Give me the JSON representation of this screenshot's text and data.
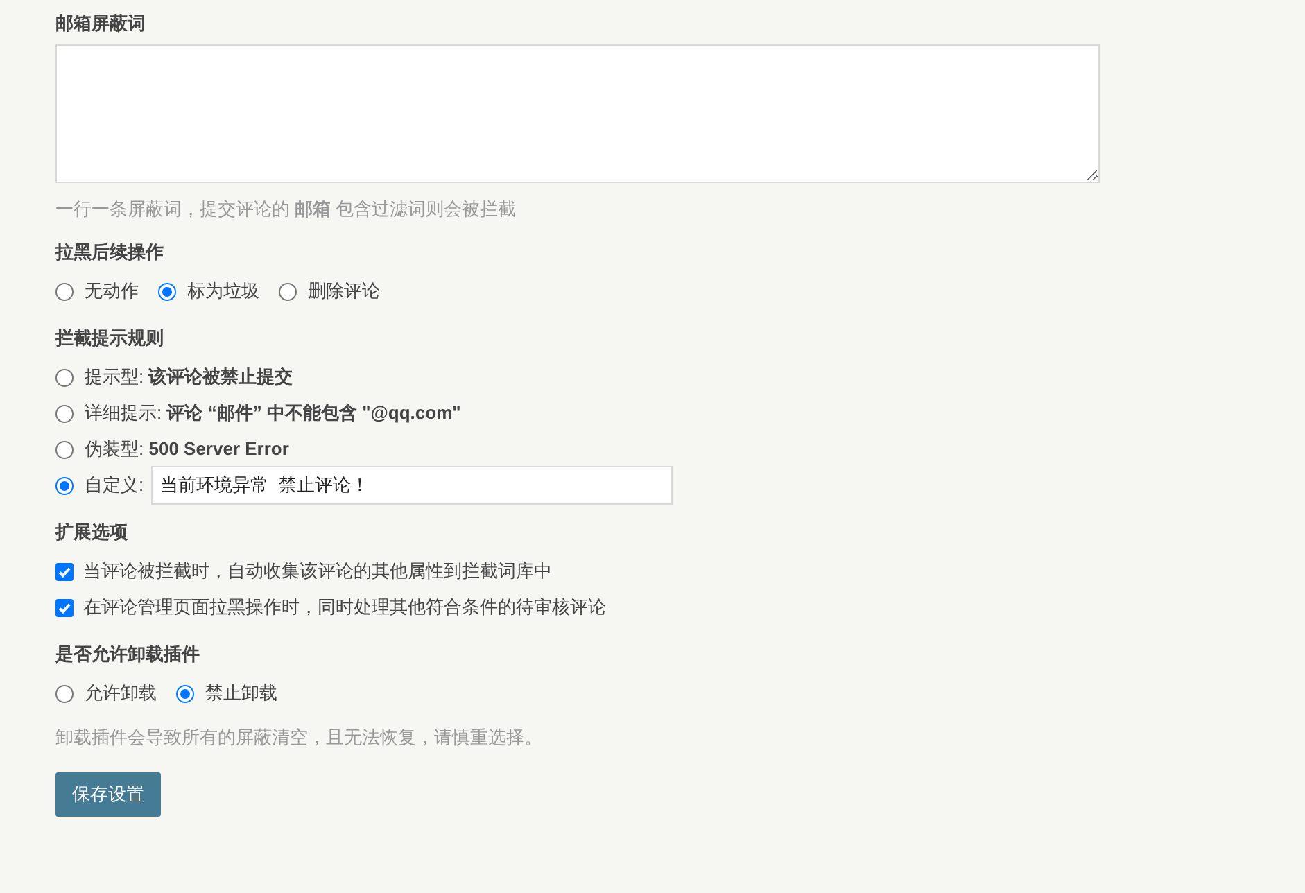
{
  "sections": [
    {
      "kind": "textarea",
      "title": "邮箱屏蔽词",
      "hint": "一行一条屏蔽词，提交评论的 **邮箱** 包含过滤词则会被拦截"
    },
    {
      "kind": "radio-inline",
      "title": "拉黑后续操作",
      "options": [
        {
          "label": "无动作",
          "selected": false
        },
        {
          "label": "标为垃圾",
          "selected": true
        },
        {
          "label": "删除评论",
          "selected": false
        }
      ]
    },
    {
      "kind": "radio-list",
      "title": "拦截提示规则",
      "options": [
        {
          "label": "提示型: **该评论被禁止提交**",
          "selected": false
        },
        {
          "label": "详细提示: **评论 “邮件” 中不能包含 \"@qq.com\"**",
          "selected": false
        },
        {
          "label": "伪装型: **500 Server Error**",
          "selected": false
        },
        {
          "label": "自定义:",
          "selected": true,
          "value": "当前环境异常  禁止评论！"
        }
      ]
    },
    {
      "kind": "checkbox-list",
      "title": "扩展选项",
      "options": [
        {
          "label": "当评论被拦截时，自动收集该评论的其他属性到拦截词库中",
          "checked": true
        },
        {
          "label": "在评论管理页面拉黑操作时，同时处理其他符合条件的待审核评论",
          "checked": true
        }
      ]
    },
    {
      "kind": "radio-inline",
      "title": "是否允许卸载插件",
      "options": [
        {
          "label": "允许卸载",
          "selected": false
        },
        {
          "label": "禁止卸载",
          "selected": true
        }
      ],
      "hint": "卸载插件会导致所有的屏蔽清空，且无法恢复，请慎重选择。"
    }
  ],
  "button": "保存设置"
}
